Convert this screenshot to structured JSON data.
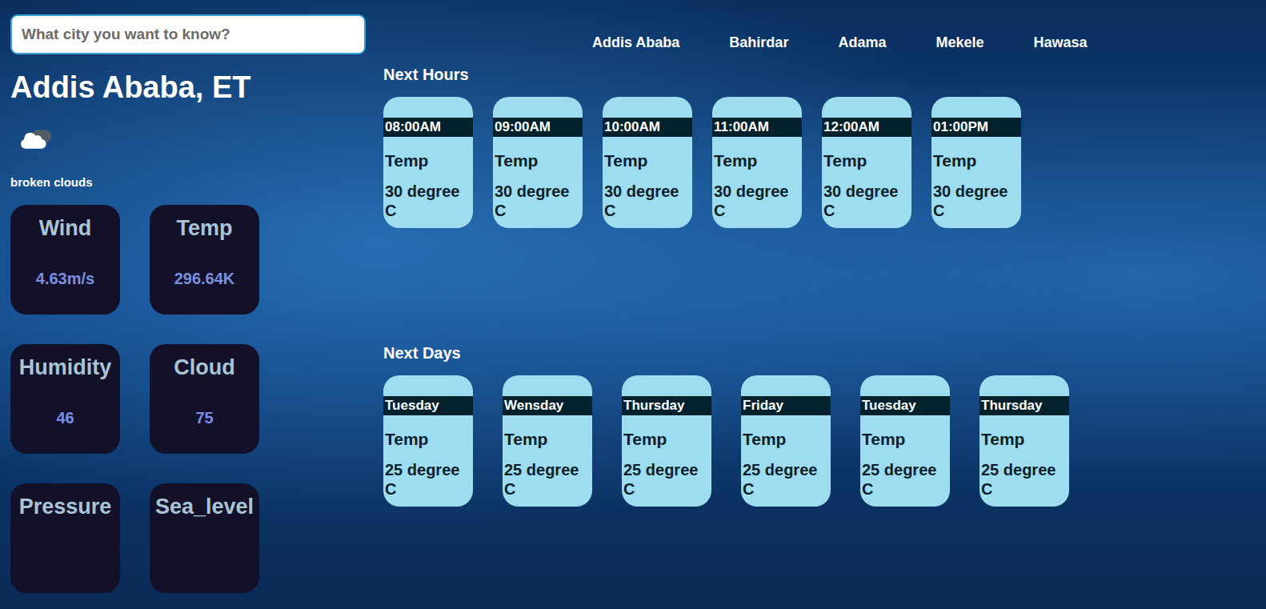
{
  "search": {
    "placeholder": "What city you want to know?"
  },
  "nav": [
    {
      "label": "Addis Ababa"
    },
    {
      "label": "Bahirdar"
    },
    {
      "label": "Adama"
    },
    {
      "label": "Mekele"
    },
    {
      "label": "Hawasa"
    }
  ],
  "current": {
    "city": "Addis Ababa, ET",
    "description": "broken clouds"
  },
  "stats": [
    {
      "label": "Wind",
      "value": "4.63m/s"
    },
    {
      "label": "Temp",
      "value": "296.64K"
    },
    {
      "label": "Humidity",
      "value": "46"
    },
    {
      "label": "Cloud",
      "value": "75"
    },
    {
      "label": "Pressure"
    },
    {
      "label": "Sea_level"
    }
  ],
  "hours": {
    "title": "Next Hours",
    "items": [
      {
        "time": "08:00AM",
        "label": "Temp",
        "value": "30 degree C"
      },
      {
        "time": "09:00AM",
        "label": "Temp",
        "value": "30 degree C"
      },
      {
        "time": "10:00AM",
        "label": "Temp",
        "value": "30 degree C"
      },
      {
        "time": "11:00AM",
        "label": "Temp",
        "value": "30 degree C"
      },
      {
        "time": "12:00AM",
        "label": "Temp",
        "value": "30 degree C"
      },
      {
        "time": "01:00PM",
        "label": "Temp",
        "value": "30 degree C"
      }
    ]
  },
  "days": {
    "title": "Next Days",
    "items": [
      {
        "day": "Tuesday",
        "label": "Temp",
        "value": "25 degree C"
      },
      {
        "day": "Wensday",
        "label": "Temp",
        "value": "25 degree C"
      },
      {
        "day": "Thursday",
        "label": "Temp",
        "value": "25 degree C"
      },
      {
        "day": "Friday",
        "label": "Temp",
        "value": "25 degree C"
      },
      {
        "day": "Tuesday",
        "label": "Temp",
        "value": "25 degree C"
      },
      {
        "day": "Thursday",
        "label": "Temp",
        "value": "25 degree C"
      }
    ]
  }
}
